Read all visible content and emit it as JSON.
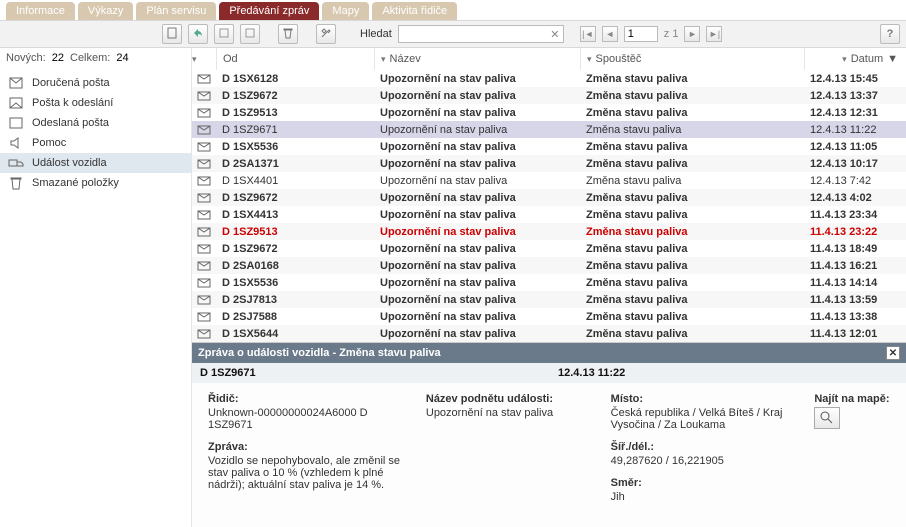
{
  "tabs": {
    "t0": "Informace",
    "t1": "Výkazy",
    "t2": "Plán servisu",
    "t3": "Předávání zpráv",
    "t4": "Mapy",
    "t5": "Aktivita řidiče"
  },
  "toolbar": {
    "search_label": "Hledat",
    "page_value": "1",
    "page_of": "z 1"
  },
  "status": {
    "new_label": "Nových:",
    "new_value": "22",
    "total_label": "Celkem:",
    "total_value": "24"
  },
  "columns": {
    "od": "Od",
    "nazev": "Název",
    "spoustec": "Spouštěč",
    "datum": "Datum"
  },
  "sidebar": {
    "items": {
      "i0": "Doručená pošta",
      "i1": "Pošta k odeslání",
      "i2": "Odeslaná pošta",
      "i3": "Pomoc",
      "i4": "Událost vozidla",
      "i5": "Smazané položky"
    }
  },
  "rows": {
    "r0": {
      "od": "D 1SX6128",
      "nazev": "Upozornění na stav paliva",
      "sp": "Změna stavu paliva",
      "datum": "12.4.13 15:45"
    },
    "r1": {
      "od": "D 1SZ9672",
      "nazev": "Upozornění na stav paliva",
      "sp": "Změna stavu paliva",
      "datum": "12.4.13 13:37"
    },
    "r2": {
      "od": "D 1SZ9513",
      "nazev": "Upozornění na stav paliva",
      "sp": "Změna stavu paliva",
      "datum": "12.4.13 12:31"
    },
    "r3": {
      "od": "D 1SZ9671",
      "nazev": "Upozornění na stav paliva",
      "sp": "Změna stavu paliva",
      "datum": "12.4.13 11:22"
    },
    "r4": {
      "od": "D 1SX5536",
      "nazev": "Upozornění na stav paliva",
      "sp": "Změna stavu paliva",
      "datum": "12.4.13 11:05"
    },
    "r5": {
      "od": "D 2SA1371",
      "nazev": "Upozornění na stav paliva",
      "sp": "Změna stavu paliva",
      "datum": "12.4.13 10:17"
    },
    "r6": {
      "od": "D 1SX4401",
      "nazev": "Upozornění na stav paliva",
      "sp": "Změna stavu paliva",
      "datum": "12.4.13 7:42"
    },
    "r7": {
      "od": "D 1SZ9672",
      "nazev": "Upozornění na stav paliva",
      "sp": "Změna stavu paliva",
      "datum": "12.4.13 4:02"
    },
    "r8": {
      "od": "D 1SX4413",
      "nazev": "Upozornění na stav paliva",
      "sp": "Změna stavu paliva",
      "datum": "11.4.13 23:34"
    },
    "r9": {
      "od": "D 1SZ9513",
      "nazev": "Upozornění na stav paliva",
      "sp": "Změna stavu paliva",
      "datum": "11.4.13 23:22"
    },
    "r10": {
      "od": "D 1SZ9672",
      "nazev": "Upozornění na stav paliva",
      "sp": "Změna stavu paliva",
      "datum": "11.4.13 18:49"
    },
    "r11": {
      "od": "D 2SA0168",
      "nazev": "Upozornění na stav paliva",
      "sp": "Změna stavu paliva",
      "datum": "11.4.13 16:21"
    },
    "r12": {
      "od": "D 1SX5536",
      "nazev": "Upozornění na stav paliva",
      "sp": "Změna stavu paliva",
      "datum": "11.4.13 14:14"
    },
    "r13": {
      "od": "D 2SJ7813",
      "nazev": "Upozornění na stav paliva",
      "sp": "Změna stavu paliva",
      "datum": "11.4.13 13:59"
    },
    "r14": {
      "od": "D 2SJ7588",
      "nazev": "Upozornění na stav paliva",
      "sp": "Změna stavu paliva",
      "datum": "11.4.13 13:38"
    },
    "r15": {
      "od": "D 1SX5644",
      "nazev": "Upozornění na stav paliva",
      "sp": "Změna stavu paliva",
      "datum": "11.4.13 12:01"
    }
  },
  "detail": {
    "title": "Zpráva o události vozidla - Změna stavu paliva",
    "vehicle": "D 1SZ9671",
    "datetime": "12.4.13 11:22",
    "driver_label": "Řidič:",
    "driver_value": "Unknown-00000000024A6000 D 1SZ9671",
    "msg_label": "Zpráva:",
    "msg_value": "Vozidlo se nepohybovalo, ale změnil se stav paliva o 10 % (vzhledem k plné nádrži); aktuální stav paliva je 14 %.",
    "trigger_name_label": "Název podnětu události:",
    "trigger_name_value": "Upozornění na stav paliva",
    "place_label": "Místo:",
    "place_value": "Česká republika / Velká Bíteš / Kraj Vysočina / Za Loukama",
    "coord_label": "Šíř./dél.:",
    "coord_value": "49,287620 / 16,221905",
    "dir_label": "Směr:",
    "dir_value": "Jih",
    "map_label": "Najít na mapě:"
  }
}
